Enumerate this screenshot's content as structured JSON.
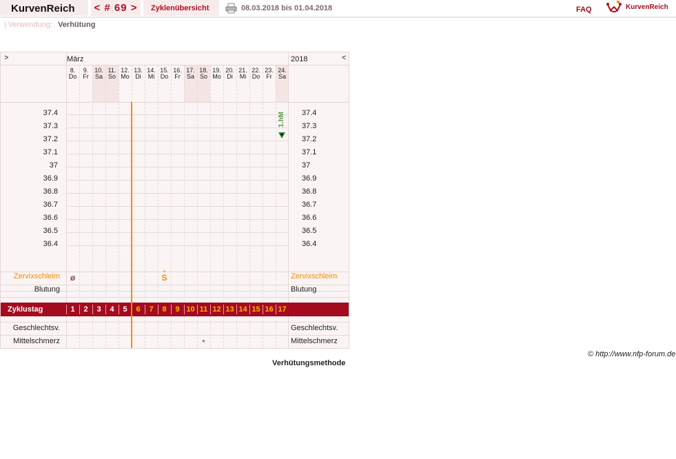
{
  "header": {
    "app_title": "KurvenReich",
    "cycle_label": "< # 69 >",
    "overview_label": "Zyklenübersicht",
    "print_icon": "printer-icon",
    "date_range": "08.03.2018 bis 01.04.2018",
    "faq": "FAQ",
    "brand_icon": "crown-logo-icon",
    "brand": "KurvenReich"
  },
  "usage": {
    "label": "Verwendung:",
    "value": "Verhütung"
  },
  "chart": {
    "nav_next": ">",
    "nav_prev": "<",
    "month": "März",
    "year": "2018",
    "days": [
      {
        "num": "8.",
        "wd": "Do",
        "weekend": false
      },
      {
        "num": "9.",
        "wd": "Fr",
        "weekend": false
      },
      {
        "num": "10.",
        "wd": "Sa",
        "weekend": true
      },
      {
        "num": "11.",
        "wd": "So",
        "weekend": true
      },
      {
        "num": "12.",
        "wd": "Mo",
        "weekend": false
      },
      {
        "num": "13.",
        "wd": "Di",
        "weekend": false
      },
      {
        "num": "14.",
        "wd": "Mi",
        "weekend": false
      },
      {
        "num": "15.",
        "wd": "Do",
        "weekend": false
      },
      {
        "num": "16.",
        "wd": "Fr",
        "weekend": false
      },
      {
        "num": "17.",
        "wd": "Sa",
        "weekend": true
      },
      {
        "num": "18.",
        "wd": "So",
        "weekend": true
      },
      {
        "num": "19.",
        "wd": "Mo",
        "weekend": false
      },
      {
        "num": "20.",
        "wd": "Di",
        "weekend": false
      },
      {
        "num": "21.",
        "wd": "Mi",
        "weekend": false
      },
      {
        "num": "22.",
        "wd": "Do",
        "weekend": false
      },
      {
        "num": "23.",
        "wd": "Fr",
        "weekend": false
      },
      {
        "num": "24.",
        "wd": "Sa",
        "weekend": true
      }
    ],
    "temps": [
      "37.4",
      "37.3",
      "37.2",
      "37.1",
      "37",
      "36.9",
      "36.8",
      "36.7",
      "36.6",
      "36.5",
      "36.4"
    ],
    "annotation": "1.hM",
    "marker_icon": "green-triangle-marker-icon",
    "rows": {
      "cervix": "Zervixschleim",
      "bleeding": "Blutung",
      "cycle_day": "Zyklustag",
      "intercourse": "Geschlechtsv.",
      "midpain": "Mittelschmerz"
    },
    "cervix_marks": [
      {
        "day_index": 0,
        "symbol": "ø"
      },
      {
        "day_index": 7,
        "symbol": "S"
      }
    ],
    "cervix_plus": "+",
    "midpain_mark": {
      "day_index": 10,
      "symbol": "•"
    },
    "cycle_days": [
      "1",
      "2",
      "3",
      "4",
      "5",
      "6",
      "7",
      "8",
      "9",
      "10",
      "11",
      "12",
      "13",
      "14",
      "15",
      "16",
      "17"
    ],
    "cycle_days_highlighted_from": 6,
    "colors": {
      "accent": "#a50b1e",
      "orange": "#f08c00",
      "weekend": "#f5e4e4",
      "grid": "#e6dada",
      "chart_bg": "#fbf4f4",
      "text_orange": "#f08c00",
      "text_gray": "#7a6a6a"
    }
  },
  "footer": {
    "copyright": "© http://www.nfp-forum.de",
    "method": "Verhütungsmethode"
  }
}
